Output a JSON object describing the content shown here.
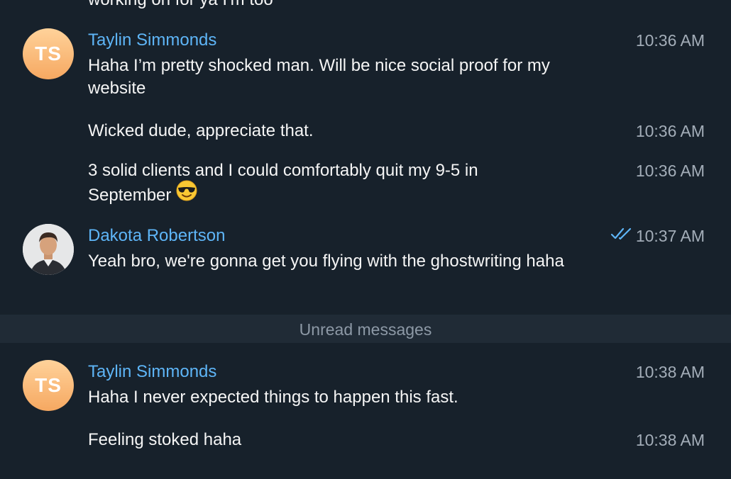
{
  "messages": {
    "partial_top": {
      "text": "working on for ya I'm too"
    },
    "group1": {
      "avatar_initials": "TS",
      "sender": "Taylin Simmonds",
      "time": "10:36 AM",
      "text": "Haha I’m pretty shocked man. Will be nice social proof for my website"
    },
    "msg2": {
      "text": "Wicked dude, appreciate that.",
      "time": "10:36 AM"
    },
    "msg3": {
      "text": "3 solid clients and I could comfortably quit my 9-5 in September",
      "time": "10:36 AM",
      "emoji": "smiling-face-with-sunglasses-icon"
    },
    "group2": {
      "sender": "Dakota Robertson",
      "time": "10:37 AM",
      "status": "read-double-check-icon",
      "text": "Yeah bro, we're gonna get you flying with the ghostwriting haha"
    },
    "unread_divider": "Unread messages",
    "group3": {
      "avatar_initials": "TS",
      "sender": "Taylin Simmonds",
      "time": "10:38 AM",
      "text": "Haha I never expected things to happen this fast."
    },
    "msg5": {
      "text": "Feeling stoked haha",
      "time": "10:38 AM"
    }
  },
  "colors": {
    "background": "#17212b",
    "sender_name": "#5eb5f7",
    "timestamp": "#a3adb8",
    "message_text": "#f5f5f5",
    "unread_bar": "#202b36",
    "avatar_gradient_top": "#ffd29a",
    "avatar_gradient_bottom": "#f6a861"
  }
}
